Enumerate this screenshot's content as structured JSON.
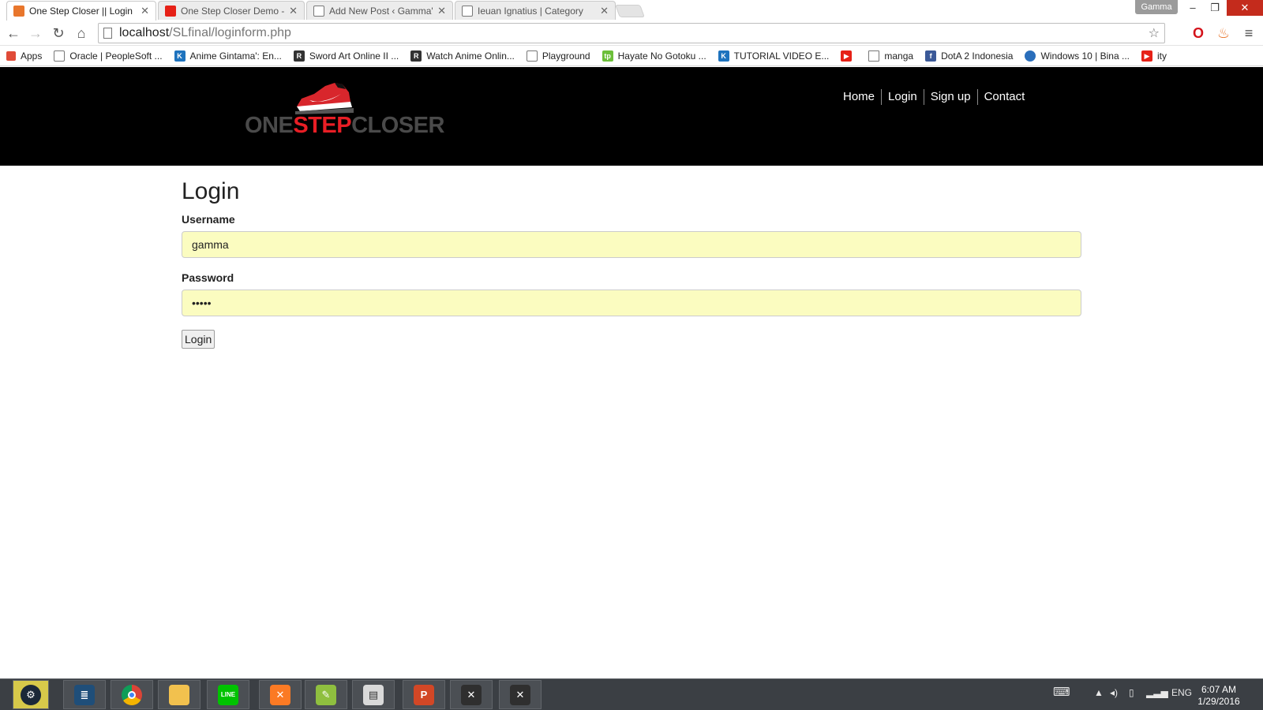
{
  "browser": {
    "tabs": [
      {
        "title": "One Step Closer || Login",
        "active": true
      },
      {
        "title": "One Step Closer Demo - Y",
        "active": false
      },
      {
        "title": "Add New Post ‹ Gamma's",
        "active": false
      },
      {
        "title": "Ieuan Ignatius | Category",
        "active": false
      }
    ],
    "profile_name": "Gamma",
    "url_host": "localhost",
    "url_path": "/SLfinal/loginform.php",
    "bookmarks": [
      "Apps",
      "Oracle | PeopleSoft ...",
      "Anime Gintama': En...",
      "Sword Art Online II ...",
      "Watch Anime Onlin...",
      "Playground",
      "Hayate No Gotoku ...",
      "TUTORIAL VIDEO E...",
      "",
      "manga",
      "DotA 2 Indonesia",
      "Windows 10 | Bina ...",
      "ity"
    ]
  },
  "site": {
    "logo": {
      "one": "ONE",
      "step": "STEP",
      "closer": "CLOSER"
    },
    "nav": [
      "Home",
      "Login",
      "Sign up",
      "Contact"
    ],
    "title": "Login",
    "username_label": "Username",
    "username_value": "gamma",
    "password_label": "Password",
    "password_value": "•••••",
    "submit_label": "Login"
  },
  "taskbar": {
    "language": "ENG",
    "time": "6:07 AM",
    "date": "1/29/2016"
  },
  "colors": {
    "header_bg": "#000000",
    "logo_red": "#e81e25",
    "autofill_bg": "#fbfcc0"
  }
}
